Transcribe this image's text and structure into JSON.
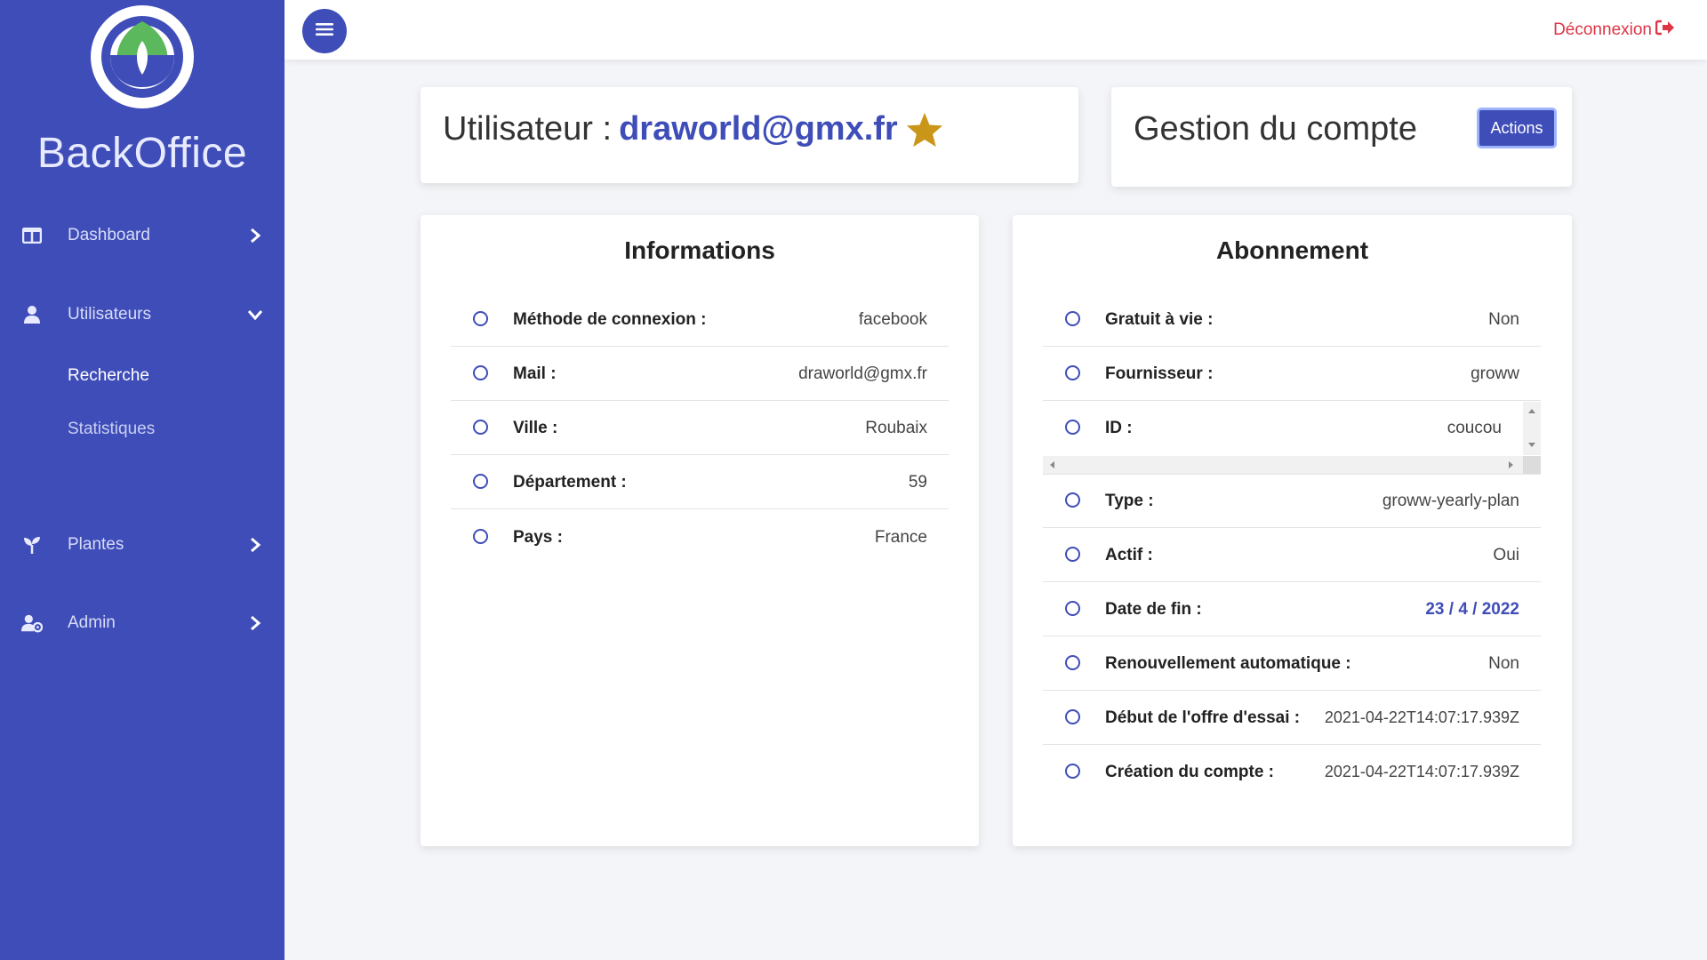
{
  "brand": "BackOffice",
  "colors": {
    "primary": "#3f4db8",
    "danger": "#dc3545",
    "star": "#c9961a",
    "leaf_green": "#5cb85c"
  },
  "sidebar": {
    "items": [
      {
        "label": "Dashboard",
        "icon": "grid-icon",
        "chevron": "chevron-right-icon"
      },
      {
        "label": "Utilisateurs",
        "icon": "user-icon",
        "chevron": "chevron-down-icon",
        "children": [
          {
            "label": "Recherche"
          },
          {
            "label": "Statistiques"
          }
        ]
      },
      {
        "label": "Plantes",
        "icon": "seedling-icon",
        "chevron": "chevron-right-icon"
      },
      {
        "label": "Admin",
        "icon": "user-cog-icon",
        "chevron": "chevron-right-icon"
      }
    ]
  },
  "topbar": {
    "menu_icon": "hamburger-icon",
    "logout_label": "Déconnexion",
    "logout_icon": "sign-out-icon"
  },
  "user_card": {
    "prefix": "Utilisateur :",
    "email": "draworld@gmx.fr",
    "badge_icon": "star-icon"
  },
  "account_card": {
    "title": "Gestion du compte",
    "actions_label": "Actions"
  },
  "informations": {
    "title": "Informations",
    "rows": [
      {
        "label": "Méthode de connexion :",
        "value": "facebook"
      },
      {
        "label": "Mail :",
        "value": "draworld@gmx.fr"
      },
      {
        "label": "Ville :",
        "value": "Roubaix"
      },
      {
        "label": "Département :",
        "value": "59"
      },
      {
        "label": "Pays :",
        "value": "France"
      }
    ]
  },
  "abonnement": {
    "title": "Abonnement",
    "rows": [
      {
        "label": "Gratuit à vie :",
        "value": "Non"
      },
      {
        "label": "Fournisseur :",
        "value": "groww"
      },
      {
        "label": "ID :",
        "value": "coucou"
      },
      {
        "label": "Type :",
        "value": "groww-yearly-plan"
      },
      {
        "label": "Actif :",
        "value": "Oui"
      },
      {
        "label": "Date de fin :",
        "value": "23 / 4 / 2022"
      },
      {
        "label": "Renouvellement automatique :",
        "value": "Non"
      },
      {
        "label": "Début de l'offre d'essai :",
        "value": "2021-04-22T14:07:17.939Z"
      },
      {
        "label": "Création du compte :",
        "value": "2021-04-22T14:07:17.939Z"
      }
    ]
  }
}
